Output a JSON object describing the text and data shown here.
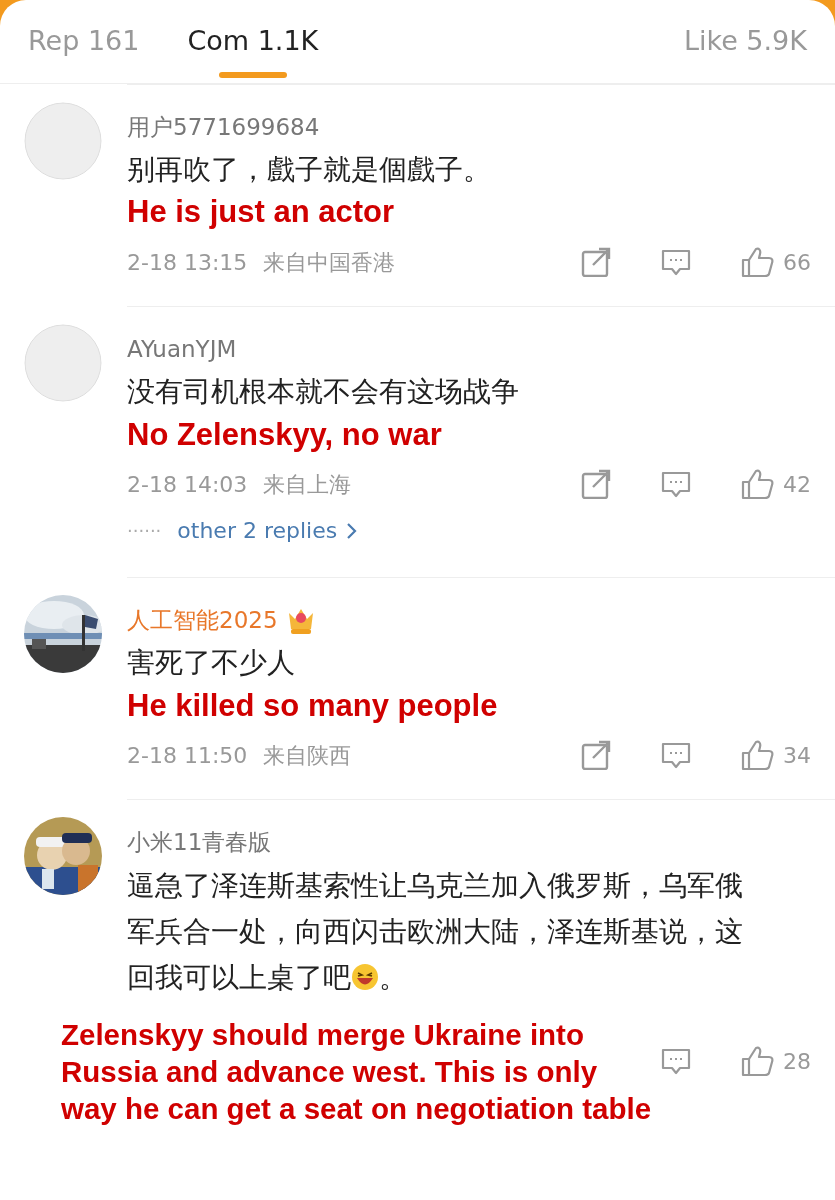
{
  "tabs": [
    {
      "label": "Rep 161",
      "selected": false
    },
    {
      "label": "Com 1.1K",
      "selected": true
    },
    {
      "label": "Like 5.9K",
      "selected": false
    }
  ],
  "comments": [
    {
      "avatar": {
        "kind": "default"
      },
      "user": "用户5771699684",
      "vip": false,
      "content": [
        {
          "kind": "text",
          "text": "别再吹了，戲子就是個戲子。"
        }
      ],
      "translation": "He is just an actor",
      "time": "2-18 13:15",
      "location": "来自中国香港",
      "actions": [
        {
          "kind": "share"
        },
        {
          "kind": "comment"
        },
        {
          "kind": "like",
          "count": "66"
        }
      ]
    },
    {
      "avatar": {
        "kind": "default"
      },
      "user": "AYuanYJM",
      "vip": false,
      "content": [
        {
          "kind": "text",
          "text": "没有司机根本就不会有这场战争"
        }
      ],
      "translation": "No Zelenskyy, no war",
      "time": "2-18 14:03",
      "location": "来自上海",
      "actions": [
        {
          "kind": "share"
        },
        {
          "kind": "comment"
        },
        {
          "kind": "like",
          "count": "42"
        }
      ],
      "replies": {
        "dots": "······",
        "label": "other 2 replies"
      }
    },
    {
      "avatar": {
        "kind": "picture"
      },
      "user": "人工智能2025",
      "vip": true,
      "content": [
        {
          "kind": "text",
          "text": "害死了不少人"
        }
      ],
      "translation": "He killed so many people",
      "time": "2-18 11:50",
      "location": "来自陕西",
      "actions": [
        {
          "kind": "share"
        },
        {
          "kind": "comment"
        },
        {
          "kind": "like",
          "count": "34"
        }
      ]
    },
    {
      "avatar": {
        "kind": "picture"
      },
      "user": "小米11青春版",
      "vip": false,
      "content": [
        {
          "kind": "text",
          "text": "逼急了泽连斯基索性让乌克兰加入俄罗斯，乌军俄军兵合一处，向西闪击欧洲大陆，泽连斯基说，这回我可以上桌了吧"
        },
        {
          "kind": "emoji"
        },
        {
          "kind": "text",
          "text": "。"
        }
      ],
      "translation": "Zelenskyy should merge Ukraine into Russia and advance west. This is only way he can get a seat on negotiation table",
      "overlay": true,
      "actions": [
        {
          "kind": "comment"
        },
        {
          "kind": "like",
          "count": "28"
        }
      ]
    }
  ]
}
